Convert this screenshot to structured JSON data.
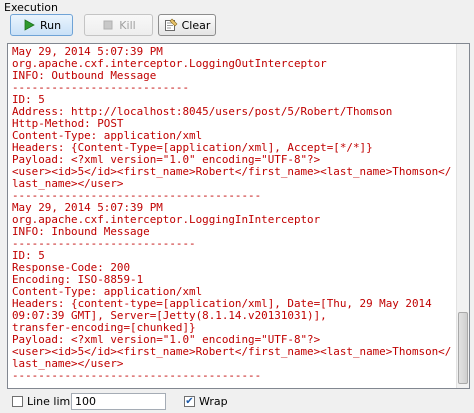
{
  "panel": {
    "title": "Execution"
  },
  "toolbar": {
    "run_label": "Run",
    "kill_label": "Kill",
    "clear_label": "Clear"
  },
  "icons": {
    "run": "play-icon",
    "kill": "stop-icon",
    "clear": "clear-console-icon"
  },
  "colors": {
    "log_text": "#c00000",
    "run_icon": "#2e9a2e"
  },
  "log": {
    "lines": [
      "May 29, 2014 5:07:39 PM",
      "org.apache.cxf.interceptor.LoggingOutInterceptor",
      "INFO: Outbound Message",
      "---------------------------",
      "ID: 5",
      "Address: http://localhost:8045/users/post/5/Robert/Thomson",
      "Http-Method: POST",
      "Content-Type: application/xml",
      "Headers: {Content-Type=[application/xml], Accept=[*/*]}",
      "Payload: <?xml version=\"1.0\" encoding=\"UTF-8\"?>",
      "<user><id>5</id><first_name>Robert</first_name><last_name>Thomson</",
      "last_name></user>",
      "--------------------------------------",
      "May 29, 2014 5:07:39 PM",
      "org.apache.cxf.interceptor.LoggingInInterceptor",
      "INFO: Inbound Message",
      "----------------------------",
      "ID: 5",
      "Response-Code: 200",
      "Encoding: ISO-8859-1",
      "Content-Type: application/xml",
      "Headers: {content-type=[application/xml], Date=[Thu, 29 May 2014",
      "09:07:39 GMT], Server=[Jetty(8.1.14.v20131031)],",
      "transfer-encoding=[chunked]}",
      "Payload: <?xml version=\"1.0\" encoding=\"UTF-8\"?>",
      "<user><id>5</id><first_name>Robert</first_name><last_name>Thomson</",
      "last_name></user>",
      "--------------------------------------"
    ]
  },
  "footer": {
    "line_limit_label": "Line limit",
    "line_limit_checked": false,
    "line_limit_value": "100",
    "wrap_label": "Wrap",
    "wrap_checked": true
  }
}
